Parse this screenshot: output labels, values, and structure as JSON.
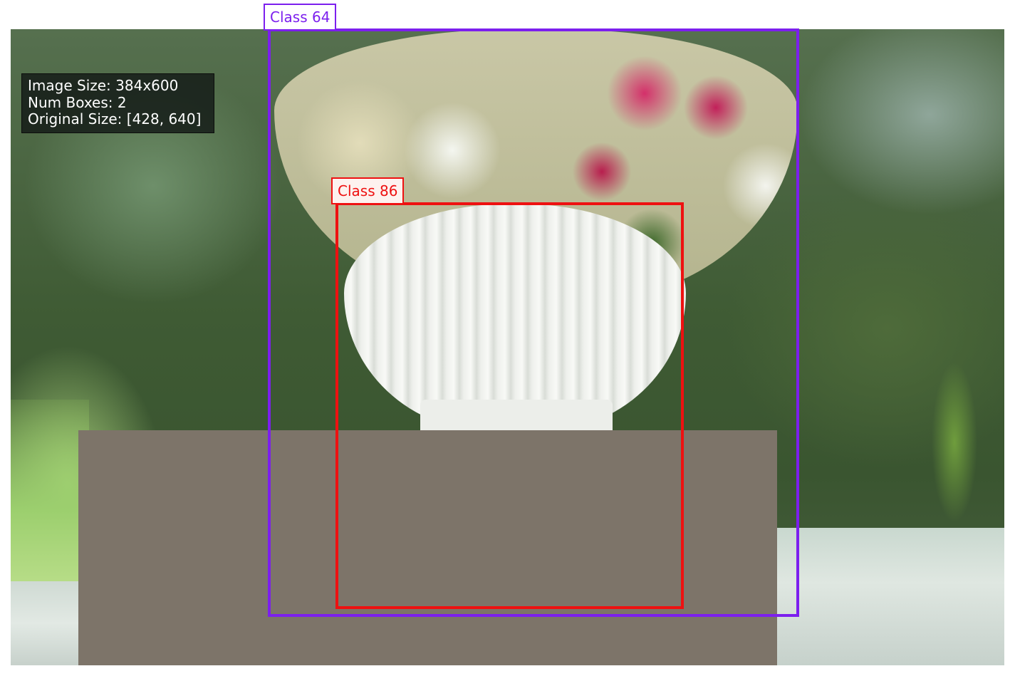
{
  "info": {
    "image_size": "Image Size: 384x600",
    "num_boxes": "Num Boxes: 2",
    "original_size": "Original Size: [428, 640]"
  },
  "boxes": [
    {
      "label": "Class 64",
      "color": "#7c1fee"
    },
    {
      "label": "Class 86",
      "color": "#ee1111"
    }
  ],
  "colors": {
    "masked_region": "#7d7469"
  }
}
